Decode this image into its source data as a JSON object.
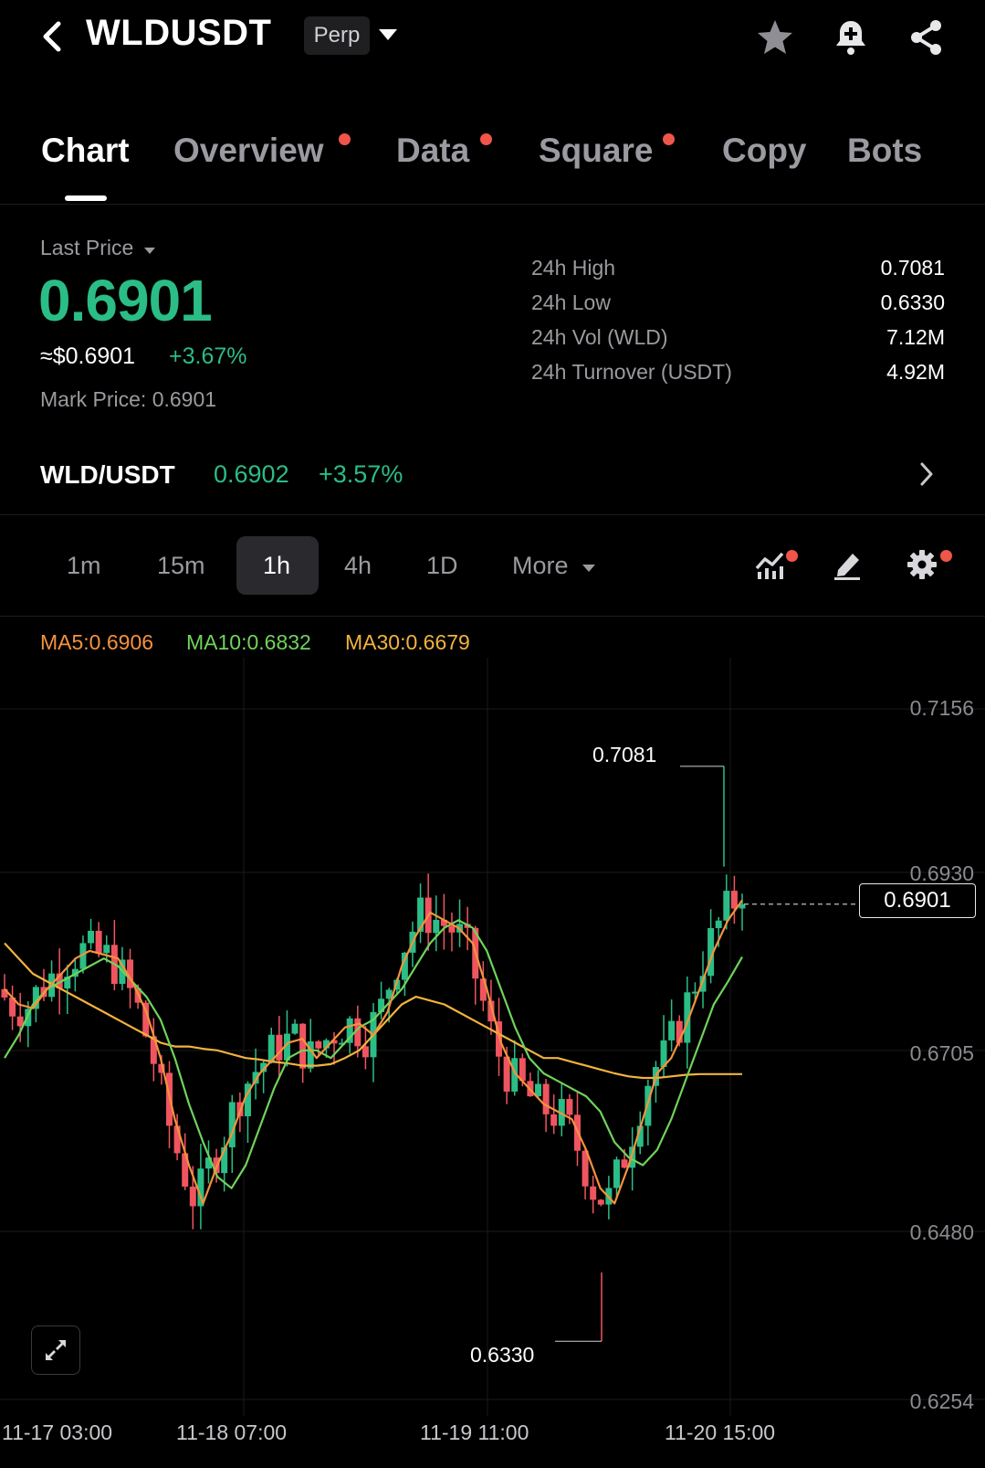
{
  "header": {
    "title": "WLDUSDT",
    "badge": "Perp",
    "icons": [
      "back-icon",
      "star-icon",
      "bell-plus-icon",
      "share-icon"
    ]
  },
  "tabs": [
    {
      "label": "Chart",
      "active": true,
      "dot": false
    },
    {
      "label": "Overview",
      "active": false,
      "dot": true
    },
    {
      "label": "Data",
      "active": false,
      "dot": true
    },
    {
      "label": "Square",
      "active": false,
      "dot": true
    },
    {
      "label": "Copy",
      "active": false,
      "dot": false
    },
    {
      "label": "Bots",
      "active": false,
      "dot": false
    }
  ],
  "ticker": {
    "last_price_label": "Last Price",
    "last_price": "0.6901",
    "usd_value": "≈$0.6901",
    "change": "+3.67%",
    "mark_label": "Mark Price:",
    "mark_value": "0.6901",
    "stats": [
      {
        "label": "24h High",
        "value": "0.7081"
      },
      {
        "label": "24h Low",
        "value": "0.6330"
      },
      {
        "label": "24h Vol (WLD)",
        "value": "7.12M"
      },
      {
        "label": "24h Turnover (USDT)",
        "value": "4.92M"
      }
    ]
  },
  "spot": {
    "pair": "WLD/USDT",
    "price": "0.6902",
    "change": "+3.57%"
  },
  "timeframes": {
    "items": [
      "1m",
      "15m",
      "1h",
      "4h",
      "1D"
    ],
    "active": "1h",
    "more_label": "More"
  },
  "ma": {
    "ma5": "MA5:0.6906",
    "ma10": "MA10:0.6832",
    "ma30": "MA30:0.6679",
    "colors": {
      "ma5": "#f5923e",
      "ma10": "#6fd35b",
      "ma30": "#f2b33d"
    }
  },
  "colors": {
    "up": "#2bbd86",
    "down": "#f0555f",
    "accent_dot": "#f0554a"
  },
  "chart_data": {
    "type": "candlestick",
    "y_ticks": [
      "0.7156",
      "0.6930",
      "0.6705",
      "0.6480",
      "0.6254"
    ],
    "ylim": [
      0.6254,
      0.7156
    ],
    "x_ticks": [
      "11-17 03:00",
      "11-18 07:00",
      "11-19 11:00",
      "11-20 15:00"
    ],
    "high_marker": "0.7081",
    "low_marker": "0.6330",
    "current_price_label": "0.6901",
    "current_price": 0.6901,
    "ma5": [
      0.679,
      0.677,
      0.6765,
      0.679,
      0.681,
      0.683,
      0.684,
      0.6835,
      0.683,
      0.68,
      0.676,
      0.67,
      0.662,
      0.656,
      0.651,
      0.656,
      0.66,
      0.665,
      0.668,
      0.67,
      0.672,
      0.6725,
      0.67,
      0.672,
      0.674,
      0.6745,
      0.673,
      0.676,
      0.682,
      0.686,
      0.689,
      0.688,
      0.687,
      0.685,
      0.679,
      0.672,
      0.668,
      0.666,
      0.664,
      0.663,
      0.662,
      0.658,
      0.653,
      0.651,
      0.656,
      0.662,
      0.668,
      0.67,
      0.674,
      0.679,
      0.684,
      0.688,
      0.6906
    ],
    "ma10": [
      0.67,
      0.673,
      0.677,
      0.679,
      0.68,
      0.681,
      0.682,
      0.683,
      0.682,
      0.68,
      0.678,
      0.675,
      0.67,
      0.664,
      0.659,
      0.6545,
      0.653,
      0.656,
      0.661,
      0.666,
      0.67,
      0.671,
      0.671,
      0.67,
      0.672,
      0.674,
      0.675,
      0.677,
      0.679,
      0.682,
      0.685,
      0.687,
      0.688,
      0.687,
      0.684,
      0.679,
      0.674,
      0.67,
      0.668,
      0.667,
      0.666,
      0.665,
      0.663,
      0.659,
      0.657,
      0.656,
      0.658,
      0.662,
      0.667,
      0.672,
      0.677,
      0.68,
      0.6832
    ],
    "ma30": [
      0.685,
      0.683,
      0.681,
      0.68,
      0.679,
      0.678,
      0.677,
      0.676,
      0.675,
      0.674,
      0.673,
      0.672,
      0.6715,
      0.6715,
      0.6712,
      0.671,
      0.6705,
      0.67,
      0.6698,
      0.6695,
      0.6693,
      0.669,
      0.669,
      0.6692,
      0.67,
      0.671,
      0.673,
      0.675,
      0.677,
      0.678,
      0.6775,
      0.677,
      0.676,
      0.675,
      0.674,
      0.673,
      0.672,
      0.671,
      0.67,
      0.67,
      0.6695,
      0.669,
      0.6685,
      0.668,
      0.6676,
      0.6674,
      0.6674,
      0.6676,
      0.6678,
      0.6679,
      0.6679,
      0.6679,
      0.6679
    ]
  }
}
